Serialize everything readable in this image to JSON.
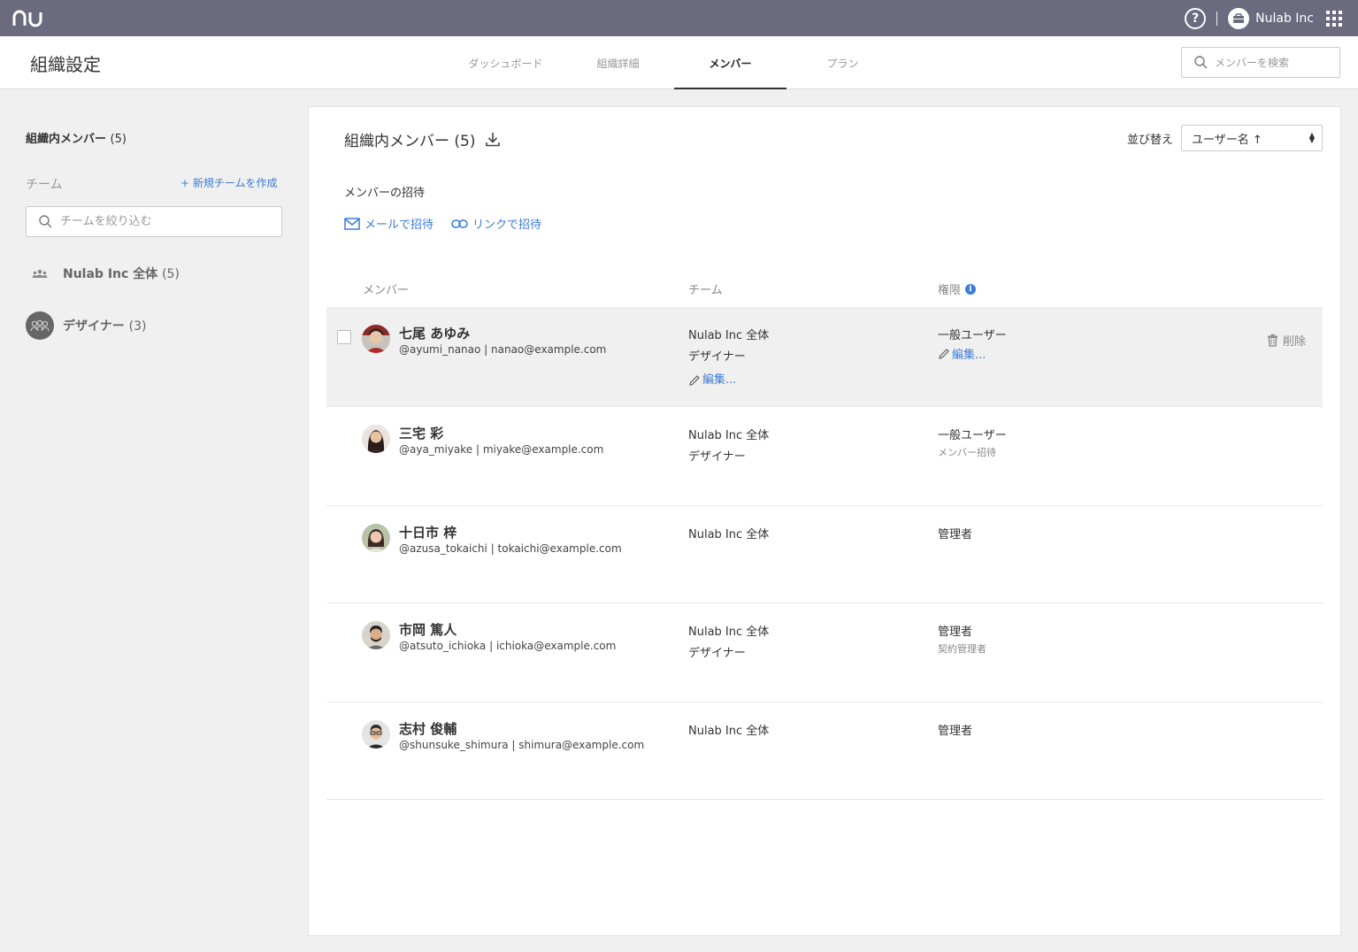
{
  "app": {
    "logo_text": "nu",
    "org_name": "Nulab Inc"
  },
  "header": {
    "title": "組織設定",
    "tabs": [
      {
        "label": "ダッシュボード",
        "active": false
      },
      {
        "label": "組織詳細",
        "active": false
      },
      {
        "label": "メンバー",
        "active": true
      },
      {
        "label": "プラン",
        "active": false
      }
    ],
    "search_placeholder": "メンバーを検索"
  },
  "sidebar": {
    "members_label": "組織内メンバー",
    "members_count": "(5)",
    "team_label": "チーム",
    "new_team_label": "+ 新規チームを作成",
    "filter_placeholder": "チームを絞り込む",
    "teams": [
      {
        "name": "Nulab Inc 全体",
        "count": "(5)"
      },
      {
        "name": "デザイナー",
        "count": "(3)"
      }
    ]
  },
  "main": {
    "title": "組織内メンバー (5)",
    "sort_label": "並び替え",
    "sort_value": "ユーザー名 ↑",
    "invite_title": "メンバーの招待",
    "invite_email": "メールで招待",
    "invite_link": "リンクで招待",
    "columns": {
      "member": "メンバー",
      "team": "チーム",
      "role": "権限"
    },
    "edit_label": "編集...",
    "delete_label": "削除",
    "members": [
      {
        "name": "七尾 あゆみ",
        "handle": "@ayumi_nanao | nanao@example.com",
        "teams": [
          "Nulab Inc 全体",
          "デザイナー"
        ],
        "role": "一般ユーザー",
        "role_sub": "",
        "selected": true
      },
      {
        "name": "三宅 彩",
        "handle": "@aya_miyake | miyake@example.com",
        "teams": [
          "Nulab Inc 全体",
          "デザイナー"
        ],
        "role": "一般ユーザー",
        "role_sub": "メンバー招待"
      },
      {
        "name": "十日市 梓",
        "handle": "@azusa_tokaichi | tokaichi@example.com",
        "teams": [
          "Nulab Inc 全体"
        ],
        "role": "管理者",
        "role_sub": ""
      },
      {
        "name": "市岡 篤人",
        "handle": "@atsuto_ichioka | ichioka@example.com",
        "teams": [
          "Nulab Inc 全体",
          "デザイナー"
        ],
        "role": "管理者",
        "role_sub": "契約管理者"
      },
      {
        "name": "志村 俊輔",
        "handle": "@shunsuke_shimura | shimura@example.com",
        "teams": [
          "Nulab Inc 全体"
        ],
        "role": "管理者",
        "role_sub": ""
      }
    ]
  }
}
